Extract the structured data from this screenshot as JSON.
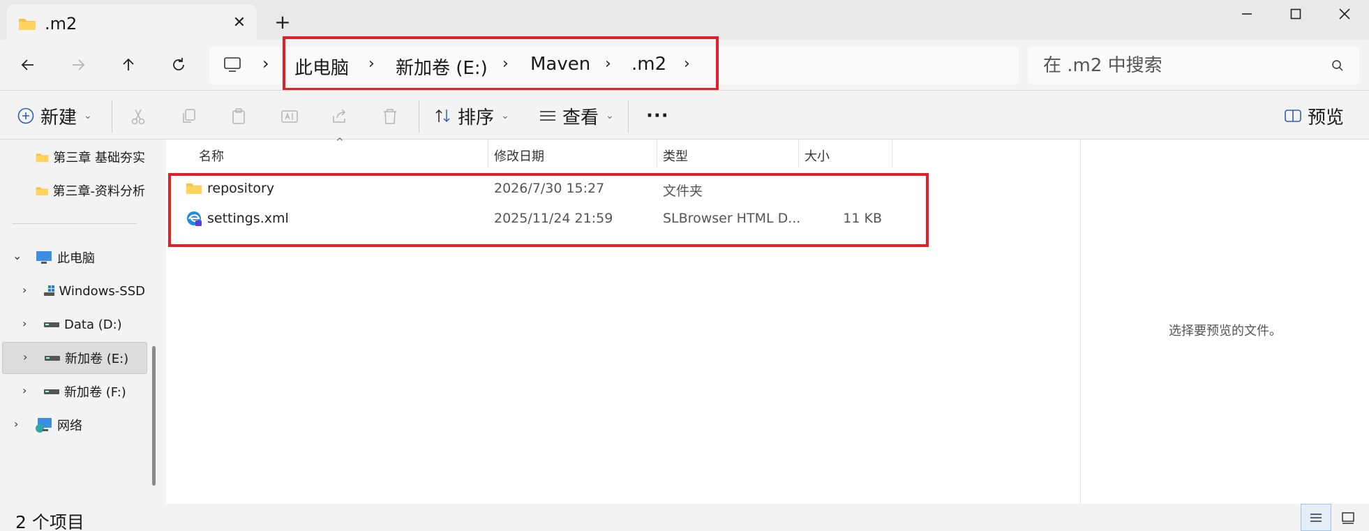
{
  "window": {
    "tab_title": ".m2",
    "tab_close": "✕",
    "new_tab": "+"
  },
  "nav": {
    "breadcrumbs": [
      "此电脑",
      "新加卷 (E:)",
      "Maven",
      ".m2"
    ],
    "search_placeholder": "在 .m2 中搜索"
  },
  "commandbar": {
    "new_label": "新建",
    "sort_label": "排序",
    "view_label": "查看",
    "more_label": "···",
    "preview_label": "预览"
  },
  "sidebar": {
    "items": [
      {
        "label": "第三章 基础夯实",
        "icon": "folder-icon"
      },
      {
        "label": "第三章-资料分析",
        "icon": "folder-icon"
      },
      {
        "label": "此电脑",
        "icon": "computer-icon"
      },
      {
        "label": "Windows-SSD",
        "icon": "drive-icon"
      },
      {
        "label": "Data (D:)",
        "icon": "drive-icon"
      },
      {
        "label": "新加卷 (E:)",
        "icon": "drive-icon"
      },
      {
        "label": "新加卷 (F:)",
        "icon": "drive-icon"
      },
      {
        "label": "网络",
        "icon": "network-icon"
      }
    ]
  },
  "files": {
    "columns": [
      "名称",
      "修改日期",
      "类型",
      "大小"
    ],
    "rows": [
      {
        "name": "repository",
        "modified": "2026/7/30 15:27",
        "type": "文件夹",
        "size": "",
        "icon": "folder-icon"
      },
      {
        "name": "settings.xml",
        "modified": "2025/11/24 21:59",
        "type": "SLBrowser HTML D...",
        "size": "11 KB",
        "icon": "browser-file-icon"
      }
    ]
  },
  "preview": {
    "message": "选择要预览的文件。"
  },
  "status": {
    "item_count": "2 个项目"
  },
  "colors": {
    "highlight": "#e0202a",
    "folder": "#f5c242",
    "selected_row": "#dcdcdc"
  }
}
